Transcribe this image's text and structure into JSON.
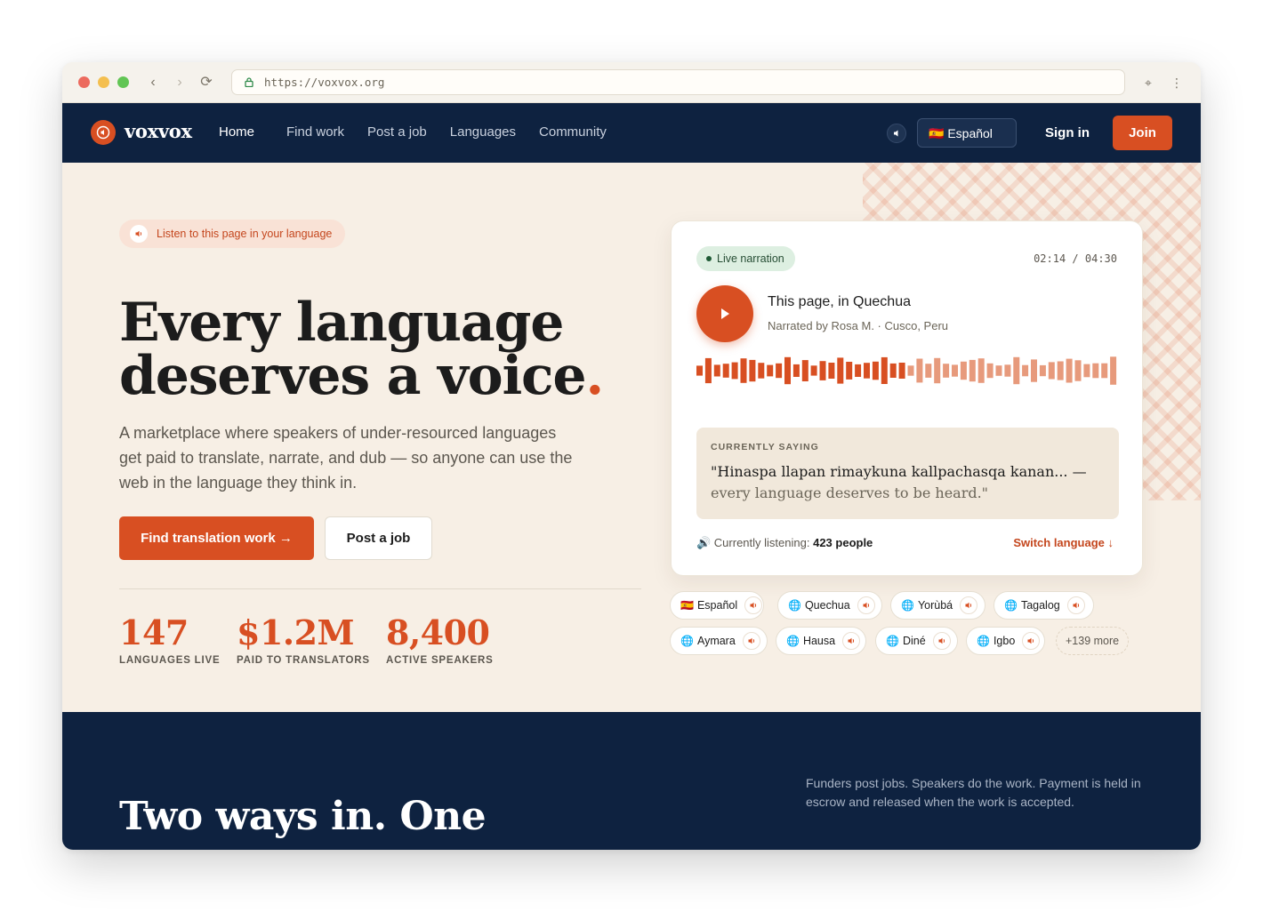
{
  "browser": {
    "url": "https://voxvox.org"
  },
  "nav": {
    "brand": "voxvox",
    "links": [
      "Home",
      "Find work",
      "Post a job",
      "Languages",
      "Community"
    ],
    "active_link": "Home",
    "language_select": "🇪🇸 Español",
    "sign_in": "Sign in",
    "join": "Join"
  },
  "hero": {
    "listen_pill": "Listen to this page in your language",
    "headline_line1": "Every language",
    "headline_line2": "deserves a voice",
    "headline_period": ".",
    "subhead": "A marketplace where speakers of under-resourced languages get paid to translate, narrate, and dub — so anyone can use the web in the language they think in.",
    "primary_cta": "Find translation work →",
    "secondary_cta": "Post a job",
    "stats": [
      {
        "value": "147",
        "label": "LANGUAGES LIVE"
      },
      {
        "value": "$1.2M",
        "label": "PAID TO TRANSLATORS"
      },
      {
        "value": "8,400",
        "label": "ACTIVE SPEAKERS"
      }
    ]
  },
  "narration_card": {
    "badge": "Live narration",
    "time": "02:14 / 04:30",
    "title": "This page, in Quechua",
    "subtitle": "Narrated by Rosa M. · Cusco, Peru",
    "progress": 0.49,
    "saying_label": "CURRENTLY SAYING",
    "saying_quote": "\"Hinaspa llapan rimaykuna kallpachasqa kanan... —",
    "saying_translation": "every language deserves to be heard.\"",
    "listening_prefix": "🔊 Currently listening:",
    "listening_count": "423 people",
    "switch_language": "Switch language ↓"
  },
  "language_chips": [
    {
      "flag": "🇪🇸",
      "name": "Español"
    },
    {
      "flag": "🌐",
      "name": "Quechua"
    },
    {
      "flag": "🌐",
      "name": "Yorùbá"
    },
    {
      "flag": "🌐",
      "name": "Tagalog"
    },
    {
      "flag": "🌐",
      "name": "Aymara"
    },
    {
      "flag": "🌐",
      "name": "Hausa"
    },
    {
      "flag": "🌐",
      "name": "Diné"
    },
    {
      "flag": "🌐",
      "name": "Igbo"
    }
  ],
  "more_languages": "+139 more",
  "lower": {
    "title": "Two ways in. One marketplace.",
    "description": "Funders post jobs. Speakers do the work. Payment is held in escrow and released when the work is accepted."
  },
  "colors": {
    "accent": "#d84f22",
    "navy": "#0e2240",
    "cream": "#f7efe5"
  },
  "icons": {
    "logo": "speaker-icon",
    "play": "play-icon",
    "chip_speaker": "speaker-icon"
  }
}
